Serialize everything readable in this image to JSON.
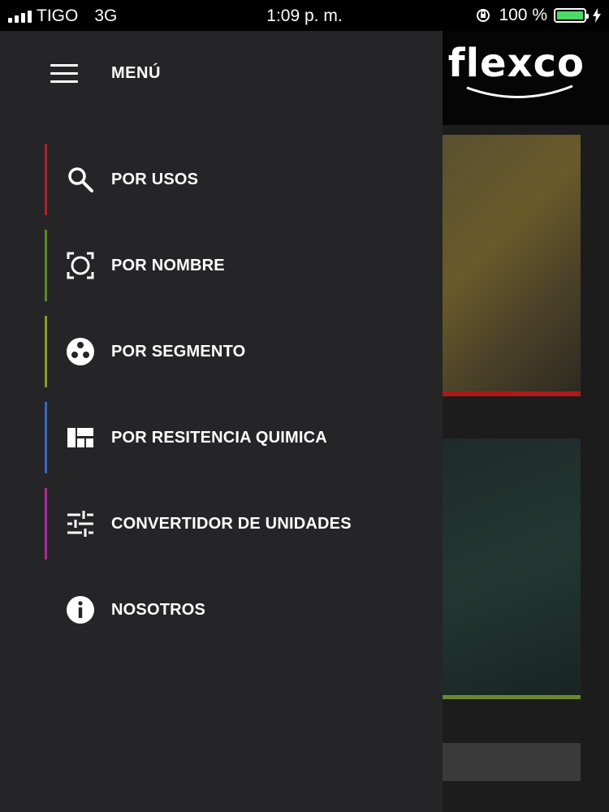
{
  "status_bar": {
    "carrier": "TIGO",
    "network": "3G",
    "time": "1:09 p. m.",
    "battery_text": "100 %",
    "battery_level": 1.0
  },
  "app": {
    "logo_text": "flexco"
  },
  "drawer": {
    "title": "MENÚ",
    "items": [
      {
        "label": "POR USOS",
        "icon": "search-icon",
        "accent": "#a8232a"
      },
      {
        "label": "POR NOMBRE",
        "icon": "scan-frame-icon",
        "accent": "#5a8a2a"
      },
      {
        "label": "POR SEGMENTO",
        "icon": "segment-circle-icon",
        "accent": "#8a9a24"
      },
      {
        "label": "POR RESITENCIA QUIMICA",
        "icon": "dashboard-grid-icon",
        "accent": "#3a66c4"
      },
      {
        "label": "CONVERTIDOR DE UNIDADES",
        "icon": "sliders-icon",
        "accent": "#b22a9a"
      },
      {
        "label": "NOSOTROS",
        "icon": "info-icon",
        "accent": ""
      }
    ]
  },
  "colors": {
    "drawer_bg": "#252527",
    "battery_green": "#4cd964"
  }
}
